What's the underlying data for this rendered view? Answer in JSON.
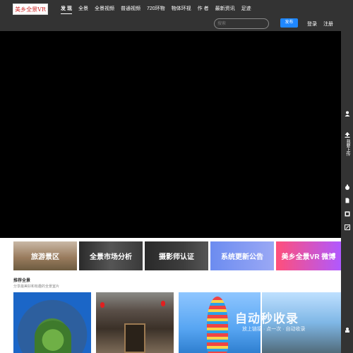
{
  "header": {
    "logo_text": "美乡全景VR",
    "nav": [
      "发 现",
      "全景",
      "全景视频",
      "普通视频",
      "720环物",
      "物体环视",
      "作 者",
      "最新资讯",
      "足迹"
    ],
    "search_placeholder": "搜索",
    "publish_label": "发布",
    "login_label": "登录",
    "register_label": "注册"
  },
  "rightbar": {
    "upload_label": "我要上传"
  },
  "banners": [
    "旅游景区",
    "全景市场分析",
    "摄影师认证",
    "系统更新公告",
    "美乡全景VR 微博"
  ],
  "section": {
    "title": "推荐全景",
    "subtitle": "分享最美好和有趣的全景室片"
  },
  "watermark": {
    "main": "自动秒收录",
    "sub": "放上链接 · 点一次 · 自动收录"
  },
  "colors": {
    "topbar": "#333333",
    "accent": "#1f87ff"
  }
}
